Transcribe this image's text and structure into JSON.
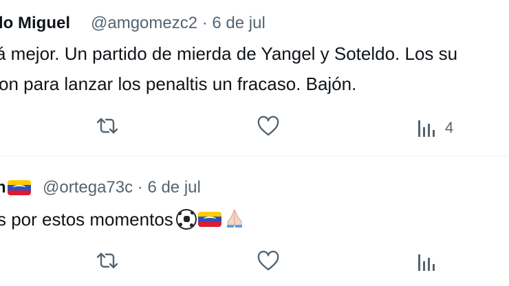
{
  "tweets": [
    {
      "display_name": "lo Miguel",
      "meta": "@amgomezc2 · 6 de jul",
      "text_lines": [
        "á mejor. Un partido de mierda de Yangel y Soteldo. Los su",
        "on para lanzar los penaltis un fracaso. Bajón."
      ],
      "views_count": "4"
    },
    {
      "display_name": "n",
      "meta": "@ortega73c · 6 de jul",
      "text_lines": [
        "s por estos momentos"
      ]
    }
  ],
  "icons": {
    "retweet": "retweet-icon",
    "like": "heart-icon",
    "views": "bar-chart-icon",
    "flag": "venezuela-flag-icon",
    "ball": "soccer-ball-icon",
    "hands": "folded-hands-icon"
  },
  "colors": {
    "text": "#0f1419",
    "muted": "#536471",
    "divider": "#eff3f4"
  }
}
